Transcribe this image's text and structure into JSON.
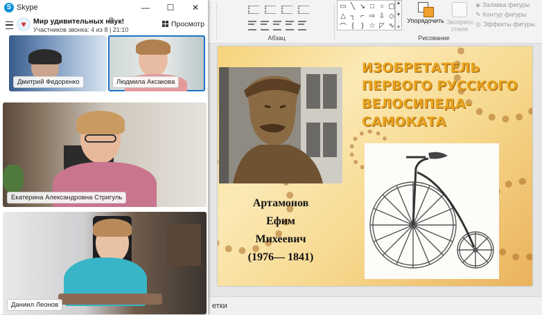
{
  "skype": {
    "app_name": "Skype",
    "window_buttons": {
      "minimize": "—",
      "maximize": "☐",
      "close": "✕"
    },
    "conversation": {
      "title": "Мир удивительных наук!",
      "subtitle": "Участников звонка: 4 из 8 | 21:10",
      "view_label": "Просмотр"
    },
    "participants": [
      {
        "name": "Дмитрий Федоренко"
      },
      {
        "name": "Людмила Аксакова"
      },
      {
        "name": "Екатерина Александровна Стригуль"
      },
      {
        "name": "Даниил Леонов"
      }
    ]
  },
  "powerpoint": {
    "ribbon": {
      "group_paragraph": "Абзац",
      "group_drawing": "Рисование",
      "arrange_label": "Упорядочить",
      "express_label_1": "Экспресс-",
      "express_label_2": "стили",
      "shape_fill": "Заливка фигуры",
      "shape_outline": "Контур фигуры",
      "shape_effects": "Эффекты фигуры"
    },
    "slide": {
      "title_lines": [
        "ИЗОБРЕТАТЕЛЬ",
        "ПЕРВОГО РУССКОГО",
        "ВЕЛОСИПЕДА-",
        "САМОКАТА"
      ],
      "name_lines": [
        "Артамонов",
        "Ефим",
        "Михеевич",
        "(1976— 1841)"
      ]
    },
    "status_text": "етки"
  },
  "colors": {
    "skype_blue": "#0a8fd6",
    "active_speaker_outline": "#1f72c7",
    "slide_title": "#e8a21c"
  }
}
